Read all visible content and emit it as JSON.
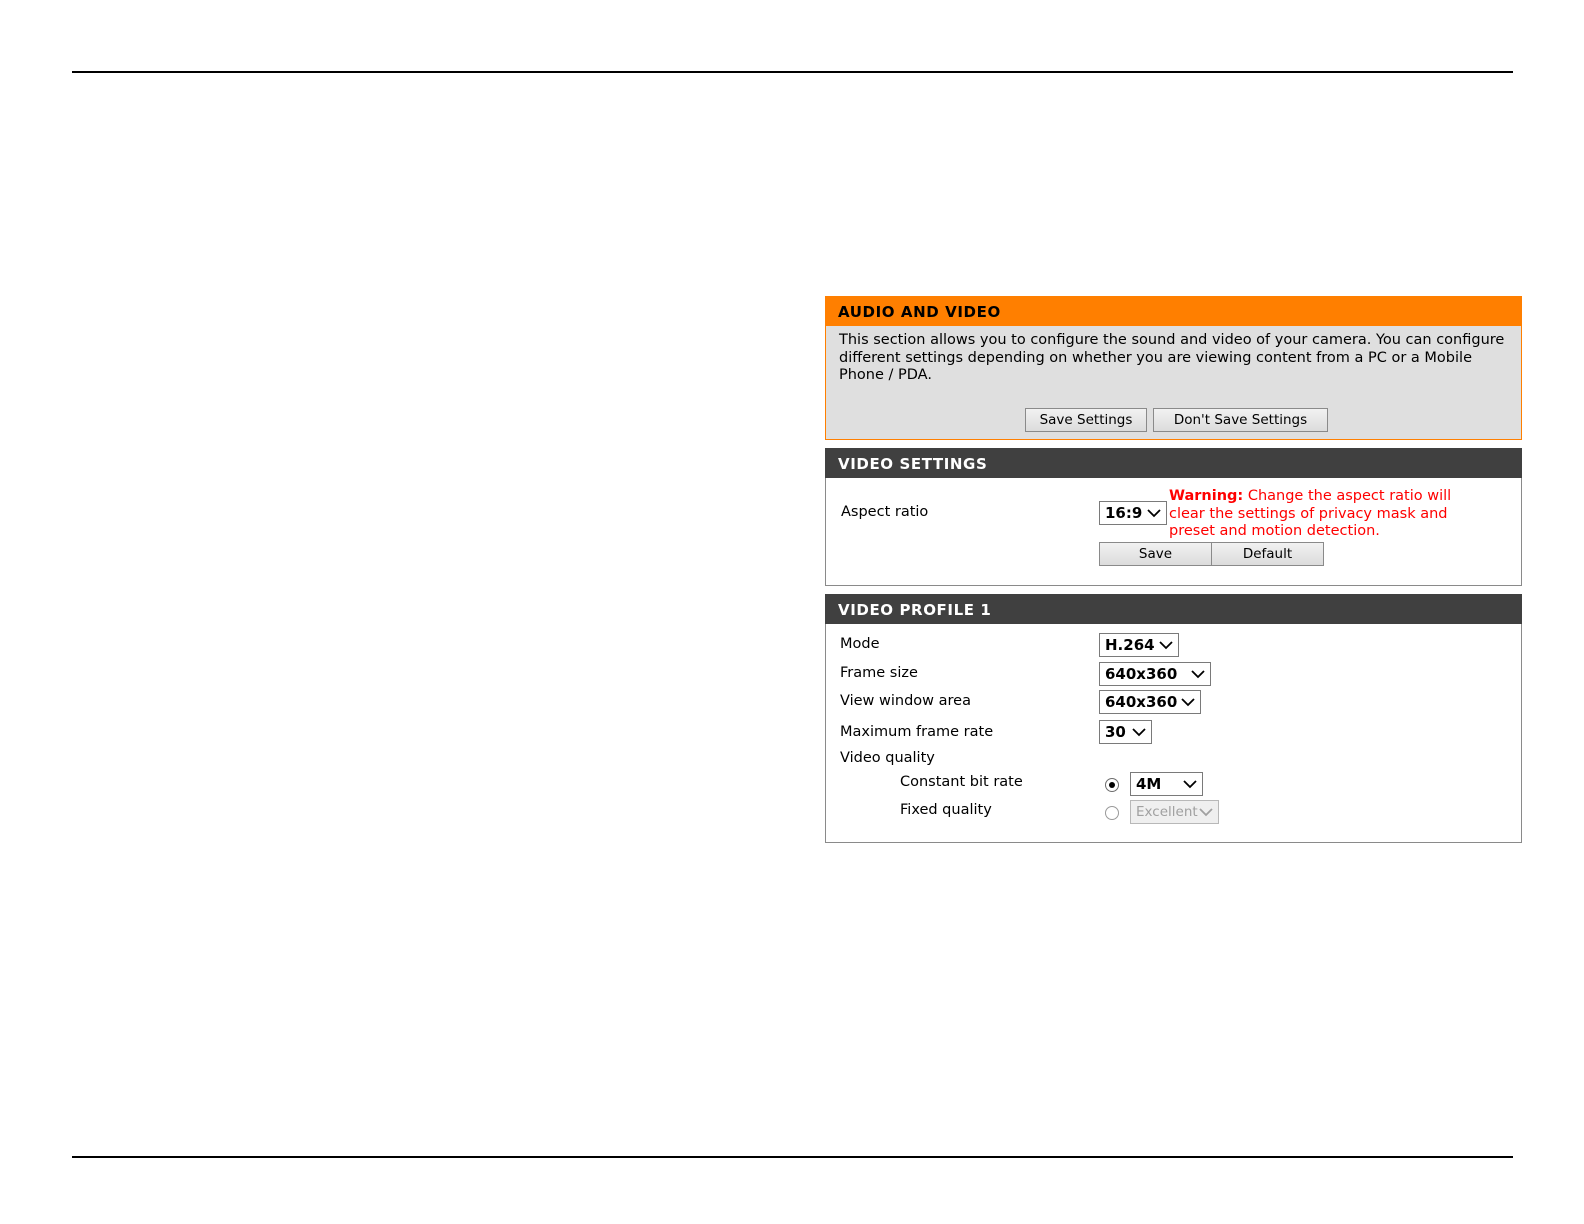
{
  "audio_video": {
    "title": "AUDIO AND VIDEO",
    "description": "This section allows you to configure the sound and video of your camera. You can configure different settings depending on whether you are viewing content from a PC or a Mobile Phone / PDA.",
    "save_settings_label": "Save Settings",
    "dont_save_settings_label": "Don't Save Settings"
  },
  "video_settings": {
    "title": "VIDEO SETTINGS",
    "aspect_ratio_label": "Aspect ratio",
    "aspect_ratio_value": "16:9",
    "warning_prefix": "Warning:",
    "warning_text": " Change the aspect ratio will clear the settings of privacy mask and preset and motion detection.",
    "save_label": "Save",
    "default_label": "Default"
  },
  "video_profile": {
    "title": "VIDEO PROFILE 1",
    "mode_label": "Mode",
    "mode_value": "H.264",
    "frame_size_label": "Frame size",
    "frame_size_value": "640x360",
    "view_window_label": "View window area",
    "view_window_value": "640x360",
    "max_frame_rate_label": "Maximum frame rate",
    "max_frame_rate_value": "30",
    "video_quality_label": "Video quality",
    "constant_bit_rate_label": "Constant bit rate",
    "constant_bit_rate_value": "4M",
    "constant_bit_rate_selected": true,
    "fixed_quality_label": "Fixed quality",
    "fixed_quality_value": "Excellent",
    "fixed_quality_selected": false
  },
  "icons": {
    "dropdown": "chevron-down-icon",
    "radio_selected": "radio-selected-icon",
    "radio_unselected": "radio-unselected-icon"
  },
  "colors": {
    "accent_orange": "#ff7f00",
    "header_dark": "#404040",
    "warning_red": "#ff0000",
    "panel_gray": "#dfdfdf"
  }
}
